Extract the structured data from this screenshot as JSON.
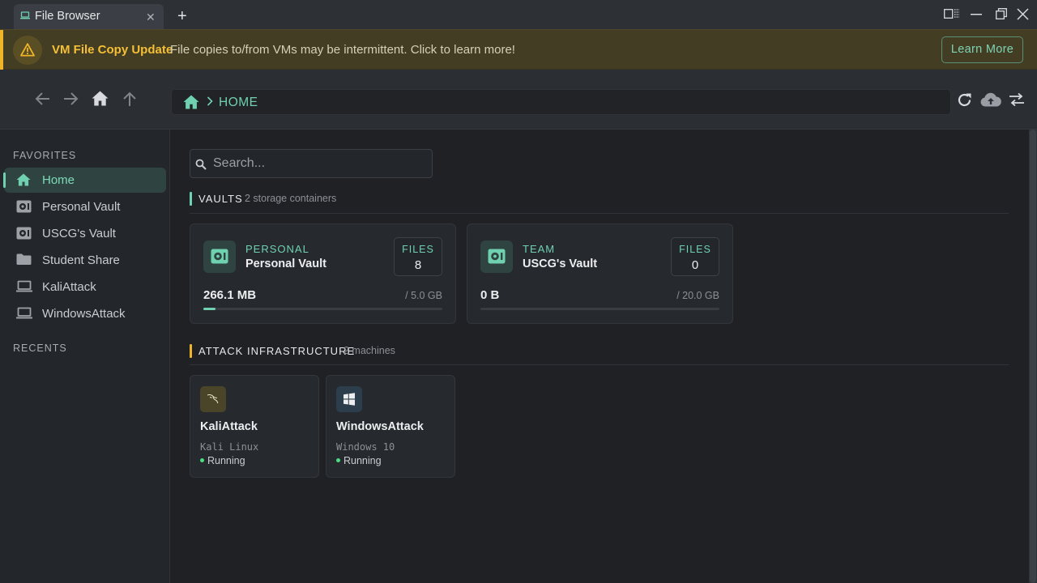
{
  "window": {
    "tab_title": "File Browser",
    "tab_icon": "laptop-icon",
    "new_tab_label": "+"
  },
  "banner": {
    "title": "VM File Copy Update",
    "message": "File copies to/from VMs may be intermittent. Click to learn more!",
    "button_label": "Learn More",
    "accent_color": "#f0b429"
  },
  "address": {
    "crumb": "HOME"
  },
  "sidebar": {
    "favorites_label": "FAVORITES",
    "recents_label": "RECENTS",
    "items": [
      {
        "label": "Home",
        "icon": "home-icon",
        "active": true
      },
      {
        "label": "Personal Vault",
        "icon": "vault-icon"
      },
      {
        "label": "USCG's Vault",
        "icon": "vault-icon"
      },
      {
        "label": "Student Share",
        "icon": "folder-icon"
      },
      {
        "label": "KaliAttack",
        "icon": "laptop-icon"
      },
      {
        "label": "WindowsAttack",
        "icon": "laptop-icon"
      }
    ]
  },
  "search": {
    "placeholder": "Search..."
  },
  "vaults": {
    "title": "VAULTS",
    "subtitle": "2 storage containers",
    "accent_color": "#6fd1b0",
    "items": [
      {
        "type": "PERSONAL",
        "name": "Personal Vault",
        "files_label": "FILES",
        "files": "8",
        "used": "266.1 MB",
        "capacity": "/ 5.0 GB",
        "usage_fraction": 0.052
      },
      {
        "type": "TEAM",
        "name": "USCG's Vault",
        "files_label": "FILES",
        "files": "0",
        "used": "0 B",
        "capacity": "/ 20.0 GB",
        "usage_fraction": 0
      }
    ]
  },
  "infrastructure": {
    "title": "ATTACK INFRASTRUCTURE",
    "subtitle": "2 machines",
    "accent_color": "#f0b429",
    "machines": [
      {
        "name": "KaliAttack",
        "os": "Kali Linux",
        "status": "Running",
        "icon": "kali-dragon-icon"
      },
      {
        "name": "WindowsAttack",
        "os": "Windows 10",
        "status": "Running",
        "icon": "windows-logo-icon"
      }
    ]
  }
}
